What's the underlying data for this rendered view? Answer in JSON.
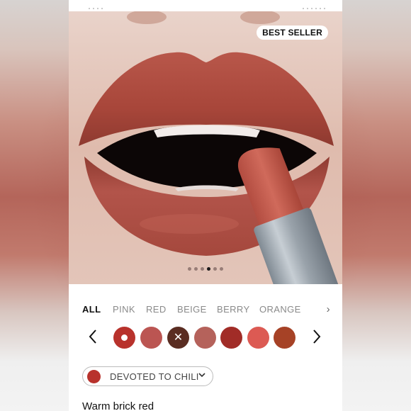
{
  "hero": {
    "badge": "BEST SELLER",
    "carousel": {
      "total": 6,
      "active_index": 3
    }
  },
  "filters": {
    "items": [
      "ALL",
      "PINK",
      "RED",
      "BEIGE",
      "BERRY",
      "ORANGE"
    ],
    "active": "ALL",
    "more_icon": "chevron-right-icon"
  },
  "swatches": {
    "prev_icon": "chevron-left-icon",
    "next_icon": "chevron-right-icon",
    "items": [
      {
        "color": "#b8322c",
        "selected": true,
        "unavailable": false
      },
      {
        "color": "#bb5552",
        "selected": false,
        "unavailable": false
      },
      {
        "color": "#5a2d22",
        "selected": false,
        "unavailable": true
      },
      {
        "color": "#b5625b",
        "selected": false,
        "unavailable": false
      },
      {
        "color": "#a12c27",
        "selected": false,
        "unavailable": false
      },
      {
        "color": "#dc5a53",
        "selected": false,
        "unavailable": false
      },
      {
        "color": "#a64226",
        "selected": false,
        "unavailable": false
      }
    ]
  },
  "shade": {
    "name": "DEVOTED TO CHILI",
    "color": "#b8322c",
    "dropdown_icon": "chevron-down-icon"
  },
  "description": "Warm brick red",
  "colors": {
    "lip": "#b3503f",
    "bullet": "#c0594a",
    "tube": "#9aa3ab"
  }
}
